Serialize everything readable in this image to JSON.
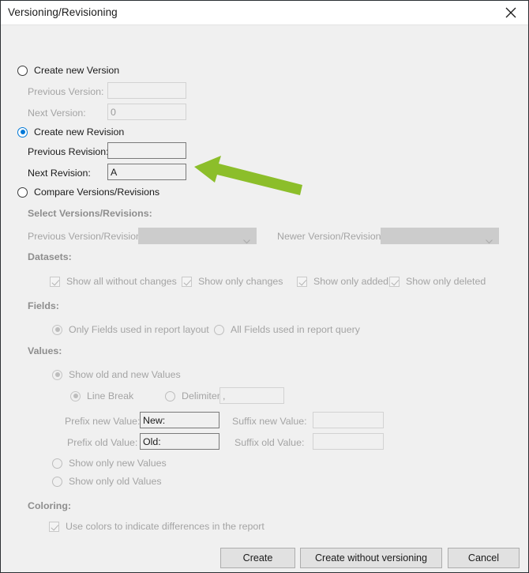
{
  "window": {
    "title": "Versioning/Revisioning",
    "close_icon": "close-icon"
  },
  "colors": {
    "accent": "#0078d7",
    "dialog_bg": "#f0f0f0",
    "titlebar_bg": "#ffffff",
    "annotation_arrow": "#8cbe2a",
    "disabled_text": "#a4a4a4",
    "group_label": "#8e8e8e"
  },
  "options": {
    "create_new_version": {
      "label": "Create new Version",
      "selected": false,
      "enabled": true,
      "fields": [
        {
          "label": "Previous Version:",
          "value": "",
          "enabled": false
        },
        {
          "label": "Next Version:",
          "value": "0",
          "enabled": false
        }
      ]
    },
    "create_new_revision": {
      "label": "Create new Revision",
      "selected": true,
      "enabled": true,
      "fields": [
        {
          "label": "Previous Revision:",
          "value": "",
          "enabled": true
        },
        {
          "label": "Next Revision:",
          "value": "A",
          "enabled": true
        }
      ]
    },
    "compare": {
      "label": "Compare Versions/Revisions",
      "selected": false,
      "enabled": true
    }
  },
  "compare_section": {
    "select_group_label": "Select Versions/Revisions:",
    "previous_label": "Previous Version/Revision:",
    "previous_value": "",
    "newer_label": "Newer Version/Revision:",
    "newer_value": "",
    "datasets_group_label": "Datasets:",
    "datasets": [
      {
        "label": "Show all without changes",
        "checked": true
      },
      {
        "label": "Show only changes",
        "checked": true
      },
      {
        "label": "Show only added",
        "checked": true
      },
      {
        "label": "Show only deleted",
        "checked": true
      }
    ],
    "fields_group_label": "Fields:",
    "fields_options": [
      {
        "label": "Only Fields used in report layout",
        "selected": true
      },
      {
        "label": "All Fields used in report query",
        "selected": false
      }
    ],
    "values_group_label": "Values:",
    "values_options": [
      {
        "label": "Show old and new Values",
        "selected": true
      },
      {
        "label": "Show only new Values",
        "selected": false
      },
      {
        "label": "Show only old Values",
        "selected": false
      }
    ],
    "separator_options": [
      {
        "label": "Line Break",
        "selected": true
      },
      {
        "label": "Delimiter:",
        "selected": false
      }
    ],
    "delimiter_value": ",",
    "prefix_new_label": "Prefix new Value:",
    "prefix_new_value": "New:",
    "suffix_new_label": "Suffix new Value:",
    "suffix_new_value": "",
    "prefix_old_label": "Prefix old Value:",
    "prefix_old_value": "Old:",
    "suffix_old_label": "Suffix old Value:",
    "suffix_old_value": "",
    "coloring_group_label": "Coloring:",
    "coloring_option": {
      "label": "Use colors to indicate differences in the report",
      "checked": true
    }
  },
  "footer": {
    "create_label": "Create",
    "create_without_versioning_label": "Create without versioning",
    "cancel_label": "Cancel"
  }
}
